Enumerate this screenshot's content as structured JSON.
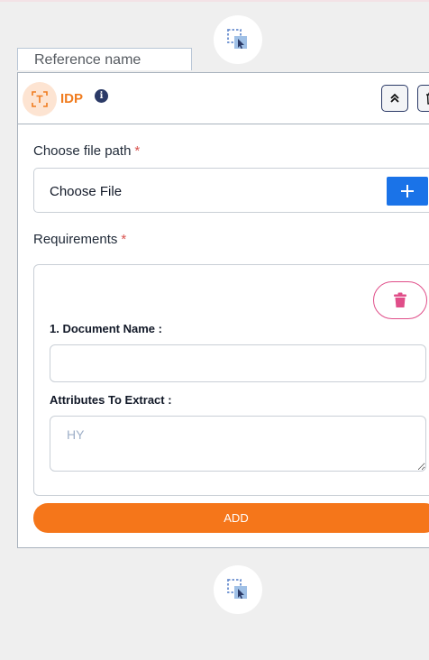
{
  "node": {
    "reference_name": "Reference name",
    "title": "IDP",
    "info_symbol": "i",
    "type_icon": "text-extract-icon",
    "header_buttons": [
      "collapse-icon",
      "trash-icon"
    ]
  },
  "file_path": {
    "label": "Choose file path",
    "required_mark": "*",
    "value": "Choose File",
    "add_icon": "plus-icon"
  },
  "requirements": {
    "label": "Requirements",
    "required_mark": "*",
    "items": [
      {
        "document_name_label": "1. Document Name :",
        "document_name_value": "",
        "attributes_label": "Attributes To Extract :",
        "attributes_placeholder": "HY"
      }
    ],
    "add_label": "ADD"
  },
  "colors": {
    "accent_orange": "#f5761a",
    "primary_blue": "#1a73e8",
    "delete_pink": "#e04e89",
    "navy": "#2b3a67"
  }
}
